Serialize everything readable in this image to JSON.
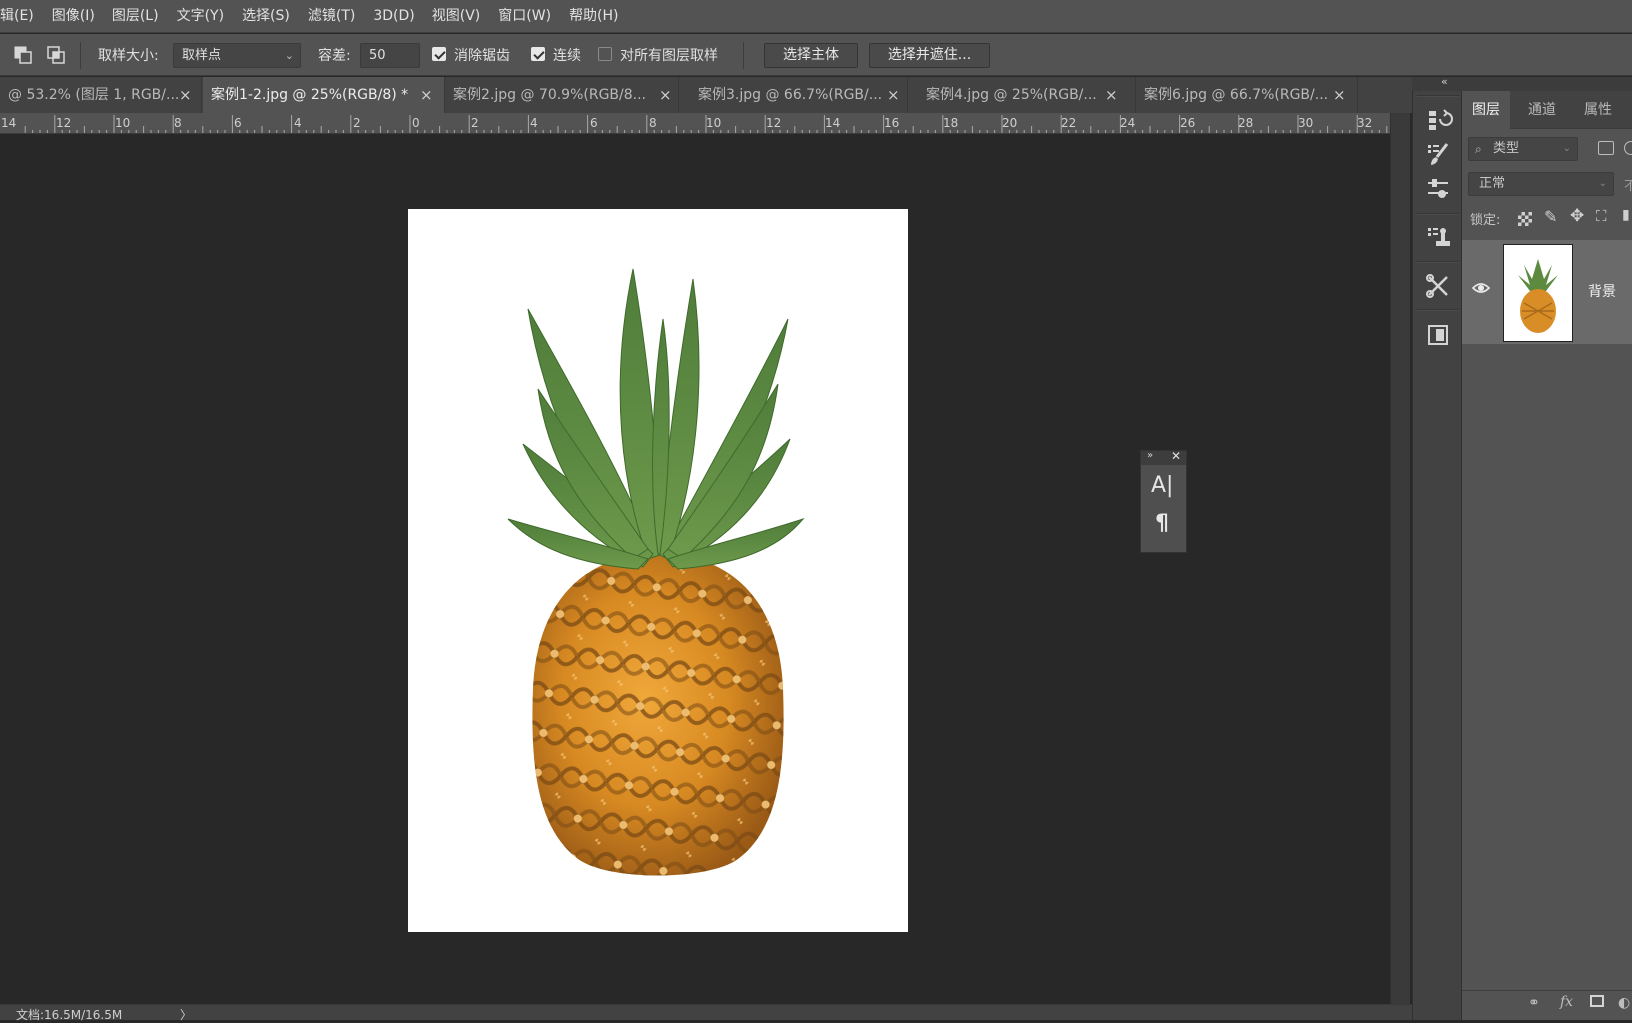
{
  "menu": {
    "items": [
      {
        "label": "辑(E)"
      },
      {
        "label": "图像(I)"
      },
      {
        "label": "图层(L)"
      },
      {
        "label": "文字(Y)"
      },
      {
        "label": "选择(S)"
      },
      {
        "label": "滤镜(T)"
      },
      {
        "label": "3D(D)"
      },
      {
        "label": "视图(V)"
      },
      {
        "label": "窗口(W)"
      },
      {
        "label": "帮助(H)"
      }
    ]
  },
  "options": {
    "sample_size_label": "取样大小:",
    "sample_size_value": "取样点",
    "tolerance_label": "容差:",
    "tolerance_value": "50",
    "anti_alias_label": "消除锯齿",
    "anti_alias_checked": true,
    "contiguous_label": "连续",
    "contiguous_checked": true,
    "sample_all_layers_label": "对所有图层取样",
    "sample_all_layers_checked": false,
    "select_subject_label": "选择主体",
    "select_and_mask_label": "选择并遮住..."
  },
  "tabs": [
    {
      "label": "@ 53.2% (图层 1, RGB/...",
      "close": "×",
      "active": false
    },
    {
      "label": "案例1-2.jpg @ 25%(RGB/8) *",
      "close": "×",
      "active": true
    },
    {
      "label": "案例2.jpg @ 70.9%(RGB/8...",
      "close": "×",
      "active": false
    },
    {
      "label": "案例3.jpg @ 66.7%(RGB/...",
      "close": "×",
      "active": false
    },
    {
      "label": "案例4.jpg @ 25%(RGB/...",
      "close": "×",
      "active": false
    },
    {
      "label": "案例6.jpg @ 66.7%(RGB/...",
      "close": "×",
      "active": false
    }
  ],
  "ruler": {
    "labels": [
      "14",
      "12",
      "10",
      "8",
      "6",
      "4",
      "2",
      "0",
      "2",
      "4",
      "6",
      "8",
      "10",
      "12",
      "14",
      "16",
      "18",
      "20",
      "22",
      "24",
      "26",
      "28",
      "30",
      "32"
    ]
  },
  "status": {
    "doc_info": "文档:16.5M/16.5M",
    "arrow": "〉"
  },
  "layers_panel": {
    "tabs": [
      {
        "label": "图层",
        "active": true
      },
      {
        "label": "通道",
        "active": false
      },
      {
        "label": "属性",
        "active": false
      }
    ],
    "filter_placeholder": "类型",
    "blend_mode": "正常",
    "opacity_partial": "不",
    "lock_label": "锁定:",
    "layers": [
      {
        "name": "背景",
        "visible": true
      }
    ]
  },
  "float_panel": {
    "character_glyph": "A|",
    "paragraph_glyph": "¶"
  },
  "canvas": {
    "background_color": "#ffffff",
    "image_subject": "pineapple"
  },
  "colors": {
    "ui_bg": "#535353",
    "canvas_bg": "#282828",
    "panel_dark": "#424242"
  }
}
